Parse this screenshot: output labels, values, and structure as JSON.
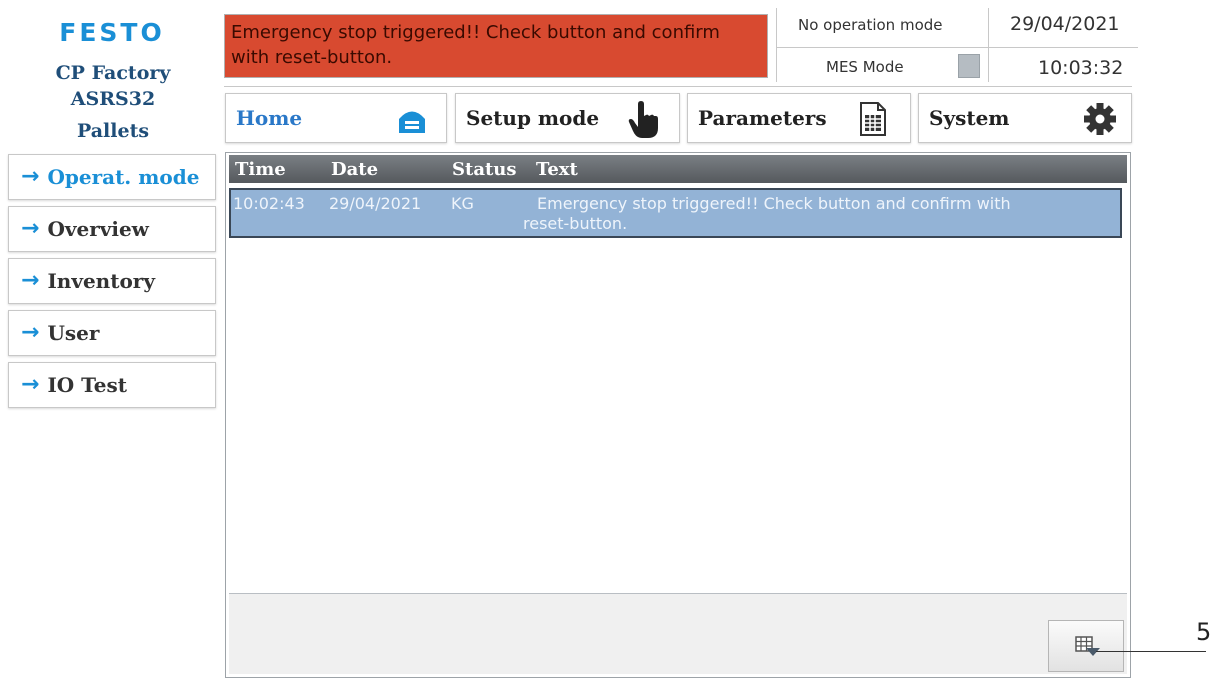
{
  "brand": {
    "logo": "FESTO",
    "line1": "CP Factory",
    "line2": "ASRS32",
    "line3": "Pallets"
  },
  "header": {
    "alarm_text": "Emergency stop triggered!! Check button and confirm with reset-button.",
    "operation_mode": "No operation mode",
    "mes_mode_label": "MES Mode",
    "date": "29/04/2021",
    "time": "10:03:32"
  },
  "top_nav": [
    {
      "label": "Home",
      "icon": "home-icon"
    },
    {
      "label": "Setup mode",
      "icon": "hand-pointer-icon"
    },
    {
      "label": "Parameters",
      "icon": "spreadsheet-icon"
    },
    {
      "label": "System",
      "icon": "gear-icon"
    }
  ],
  "sidebar": {
    "arrow": "→",
    "items": [
      {
        "label": "Operat. mode"
      },
      {
        "label": "Overview"
      },
      {
        "label": "Inventory"
      },
      {
        "label": "User"
      },
      {
        "label": "IO Test"
      }
    ]
  },
  "table": {
    "columns": [
      "Time",
      "Date",
      "Status",
      "Text"
    ],
    "rows": [
      {
        "time": "10:02:43",
        "date": "29/04/2021",
        "status": "KG",
        "text_line1": "Emergency stop triggered!! Check button and confirm with",
        "text_line2": "reset-button."
      }
    ],
    "footer_button_icon": "table-expand-icon"
  },
  "callout": {
    "number": "5"
  },
  "colors": {
    "accent": "#1a8fd6",
    "alarm": "#d84a30",
    "row_selected": "#93b3d6",
    "header_bar": "#5f6469"
  }
}
